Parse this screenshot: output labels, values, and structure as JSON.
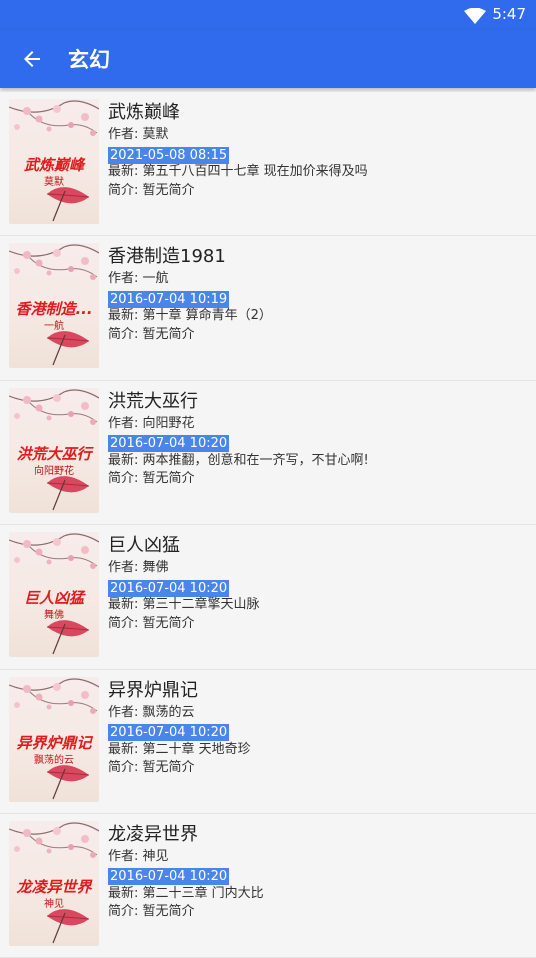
{
  "status": {
    "time": "5:47"
  },
  "header": {
    "title": "玄幻"
  },
  "labels": {
    "author_prefix": "作者: ",
    "latest_prefix": "最新: ",
    "intro_prefix": "简介: "
  },
  "books": [
    {
      "name": "武炼巅峰",
      "author": "莫默",
      "date": "2021-05-08 08:15",
      "latest": "第五千八百四十七章 现在加价来得及吗",
      "intro": "暂无简介",
      "cover_title": "武炼巅峰",
      "cover_author": "莫默"
    },
    {
      "name": "香港制造1981",
      "author": "一航",
      "date": "2016-07-04 10:19",
      "latest": "第十章 算命青年（2）",
      "intro": "暂无简介",
      "cover_title": "香港制造...",
      "cover_author": "一航"
    },
    {
      "name": "洪荒大巫行",
      "author": "向阳野花",
      "date": "2016-07-04 10:20",
      "latest": "两本推翻，创意和在一齐写，不甘心啊!",
      "intro": "暂无简介",
      "cover_title": "洪荒大巫行",
      "cover_author": "向阳野花"
    },
    {
      "name": "巨人凶猛",
      "author": "舞佛",
      "date": "2016-07-04 10:20",
      "latest": "第三十二章擎天山脉",
      "intro": "暂无简介",
      "cover_title": "巨人凶猛",
      "cover_author": "舞佛"
    },
    {
      "name": "异界炉鼎记",
      "author": "飘荡的云",
      "date": "2016-07-04 10:20",
      "latest": "第二十章 天地奇珍",
      "intro": "暂无简介",
      "cover_title": "异界炉鼎记",
      "cover_author": "飘荡的云"
    },
    {
      "name": "龙凌异世界",
      "author": "神见",
      "date": "2016-07-04 10:20",
      "latest": "第二十三章 门内大比",
      "intro": "暂无简介",
      "cover_title": "龙凌异世界",
      "cover_author": "神见"
    }
  ],
  "colors": {
    "primary": "#2f6bec",
    "date_badge": "#4a86ea",
    "cover_title": "#e01b1b"
  },
  "icons": {
    "back": "arrow-back-icon",
    "wifi": "wifi-icon"
  }
}
